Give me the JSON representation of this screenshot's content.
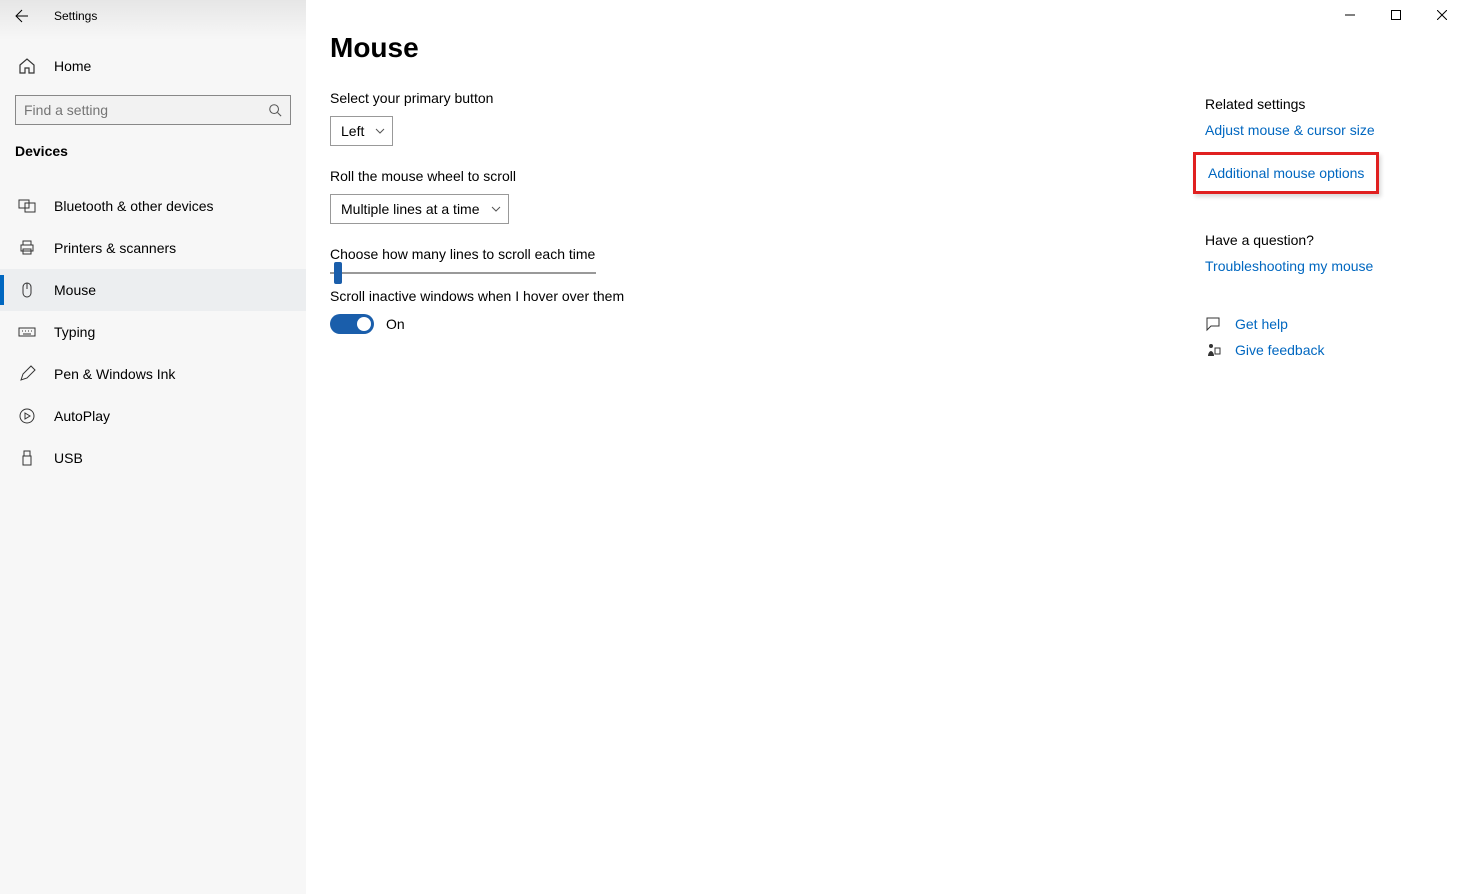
{
  "window": {
    "title": "Settings"
  },
  "sidebar": {
    "home": "Home",
    "search_placeholder": "Find a setting",
    "category": "Devices",
    "items": [
      {
        "label": "Bluetooth & other devices"
      },
      {
        "label": "Printers & scanners"
      },
      {
        "label": "Mouse"
      },
      {
        "label": "Typing"
      },
      {
        "label": "Pen & Windows Ink"
      },
      {
        "label": "AutoPlay"
      },
      {
        "label": "USB"
      }
    ]
  },
  "main": {
    "title": "Mouse",
    "primary_button_label": "Select your primary button",
    "primary_button_value": "Left",
    "wheel_scroll_label": "Roll the mouse wheel to scroll",
    "wheel_scroll_value": "Multiple lines at a time",
    "lines_label": "Choose how many lines to scroll each time",
    "inactive_label": "Scroll inactive windows when I hover over them",
    "toggle_value": "On"
  },
  "aside": {
    "related_heading": "Related settings",
    "related_links": [
      "Adjust mouse & cursor size",
      "Additional mouse options"
    ],
    "question_heading": "Have a question?",
    "question_link": "Troubleshooting my mouse",
    "help": "Get help",
    "feedback": "Give feedback"
  }
}
